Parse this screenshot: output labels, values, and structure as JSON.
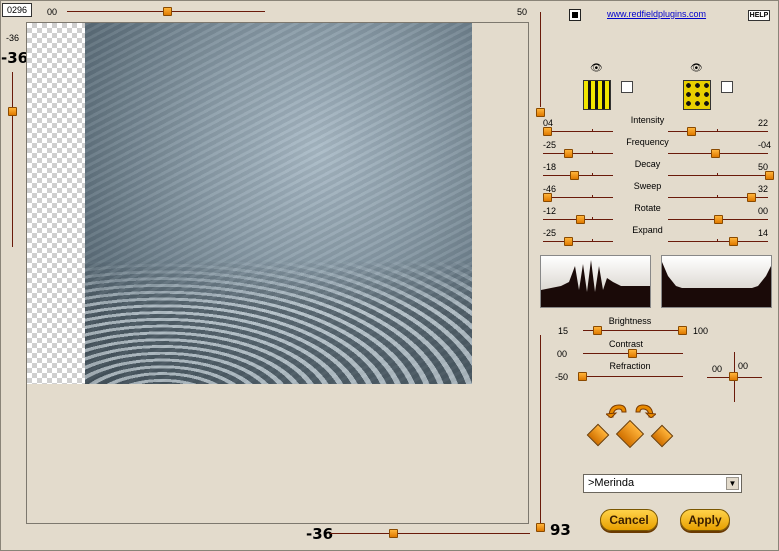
{
  "top": {
    "counter": "0296",
    "h_slider_min": "00",
    "h_slider_max": "50",
    "help_label": "HELP",
    "link": "www.redfieldplugins.com"
  },
  "left": {
    "v_value_small": "-36",
    "v_value_big": "-36"
  },
  "bottom": {
    "h_value_big": "-36",
    "right_value_big": "93"
  },
  "sliders": [
    {
      "label": "Intensity",
      "left": "04",
      "right": "22"
    },
    {
      "label": "Frequency",
      "left": "-25",
      "right": "-04"
    },
    {
      "label": "Decay",
      "left": "-18",
      "right": "50"
    },
    {
      "label": "Sweep",
      "left": "-46",
      "right": "32"
    },
    {
      "label": "Rotate",
      "left": "-12",
      "right": "00"
    },
    {
      "label": "Expand",
      "left": "-25",
      "right": "14"
    }
  ],
  "brightness": {
    "label": "Brightness",
    "left": "15",
    "right": "100"
  },
  "contrast": {
    "label": "Contrast",
    "left": "00"
  },
  "refraction": {
    "label": "Refraction",
    "left": "-50"
  },
  "crosshair": {
    "x": "00",
    "y": "00"
  },
  "preset": {
    "selected": ">Merinda"
  },
  "buttons": {
    "cancel": "Cancel",
    "apply": "Apply"
  },
  "icons": {
    "eye1": "eye-icon",
    "eye2": "eye-icon",
    "undo": "undo-arrow-icon",
    "redo": "redo-arrow-icon",
    "dice": "dice-icon"
  },
  "colors": {
    "accent": "#e89000",
    "track": "#6a1a0a",
    "bg": "#e1dacd"
  }
}
